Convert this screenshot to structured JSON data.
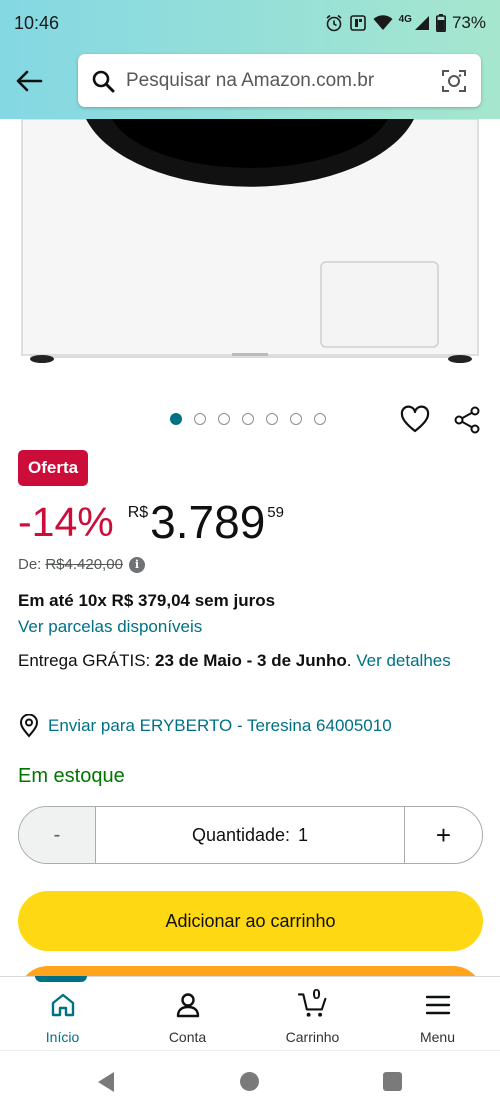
{
  "status_bar": {
    "time": "10:46",
    "network": "4G",
    "battery": "73%"
  },
  "header": {
    "search_placeholder": "Pesquisar na Amazon.com.br"
  },
  "gallery": {
    "image_count": 7,
    "active_index": 0
  },
  "product": {
    "badge": "Oferta",
    "discount": "-14%",
    "currency": "R$",
    "price_whole": "3.789",
    "price_cents": "59",
    "list_price_label": "De:",
    "list_price": "R$4.420,00",
    "installments": "Em até 10x R$ 379,04 sem juros",
    "installments_link": "Ver parcelas disponíveis",
    "delivery_prefix": "Entrega GRÁTIS: ",
    "delivery_dates": "23 de Maio - 3 de Junho",
    "delivery_suffix": ". ",
    "delivery_link": "Ver detalhes",
    "ship_to": "Enviar para ERYBERTO - Teresina 64005010",
    "stock": "Em estoque"
  },
  "quantity": {
    "minus": "-",
    "label": "Quantidade:",
    "value": "1",
    "plus": "+"
  },
  "actions": {
    "add_to_cart": "Adicionar ao carrinho"
  },
  "bottom_nav": {
    "items": [
      {
        "label": "Início",
        "icon": "home-icon"
      },
      {
        "label": "Conta",
        "icon": "account-icon"
      },
      {
        "label": "Carrinho",
        "icon": "cart-icon",
        "count": "0"
      },
      {
        "label": "Menu",
        "icon": "menu-icon"
      }
    ]
  },
  "colors": {
    "accent": "#007185",
    "deal": "#cc0c39",
    "stock": "#007600",
    "cart_button": "#ffd814",
    "buy_button": "#ffa41c"
  }
}
